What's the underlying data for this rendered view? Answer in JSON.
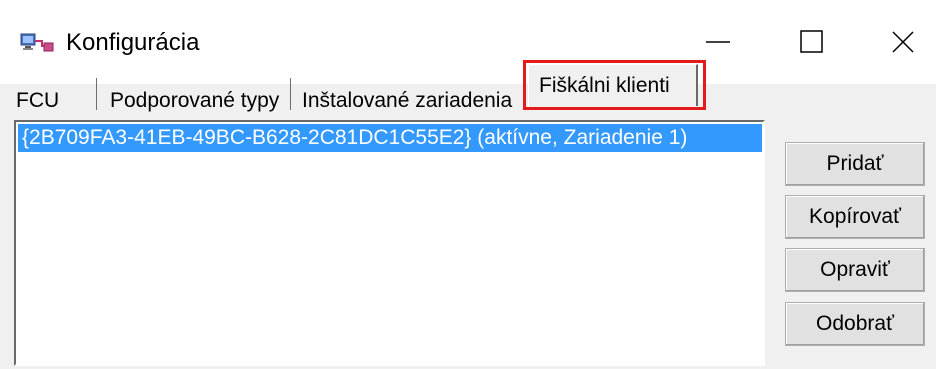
{
  "window": {
    "title": "Konfigurácia",
    "icon": "computer-network-icon",
    "controls": [
      "minimize-icon",
      "maximize-icon",
      "close-icon"
    ]
  },
  "tabs": [
    {
      "label": "FCU"
    },
    {
      "label": "Podporované typy"
    },
    {
      "label": "Inštalované zariadenia"
    },
    {
      "label": "Fiškálni klienti",
      "active": true,
      "highlighted": true
    }
  ],
  "list": {
    "items": [
      {
        "text": "{2B709FA3-41EB-49BC-B628-2C81DC1C55E2} (aktívne, Zariadenie 1)",
        "selected": true
      }
    ]
  },
  "buttons": {
    "add": "Pridať",
    "copy": "Kopírovať",
    "edit": "Opraviť",
    "remove": "Odobrať"
  },
  "colors": {
    "selection": "#3399ff",
    "highlight_border": "#e31b1b",
    "panel": "#f0f0f0"
  }
}
